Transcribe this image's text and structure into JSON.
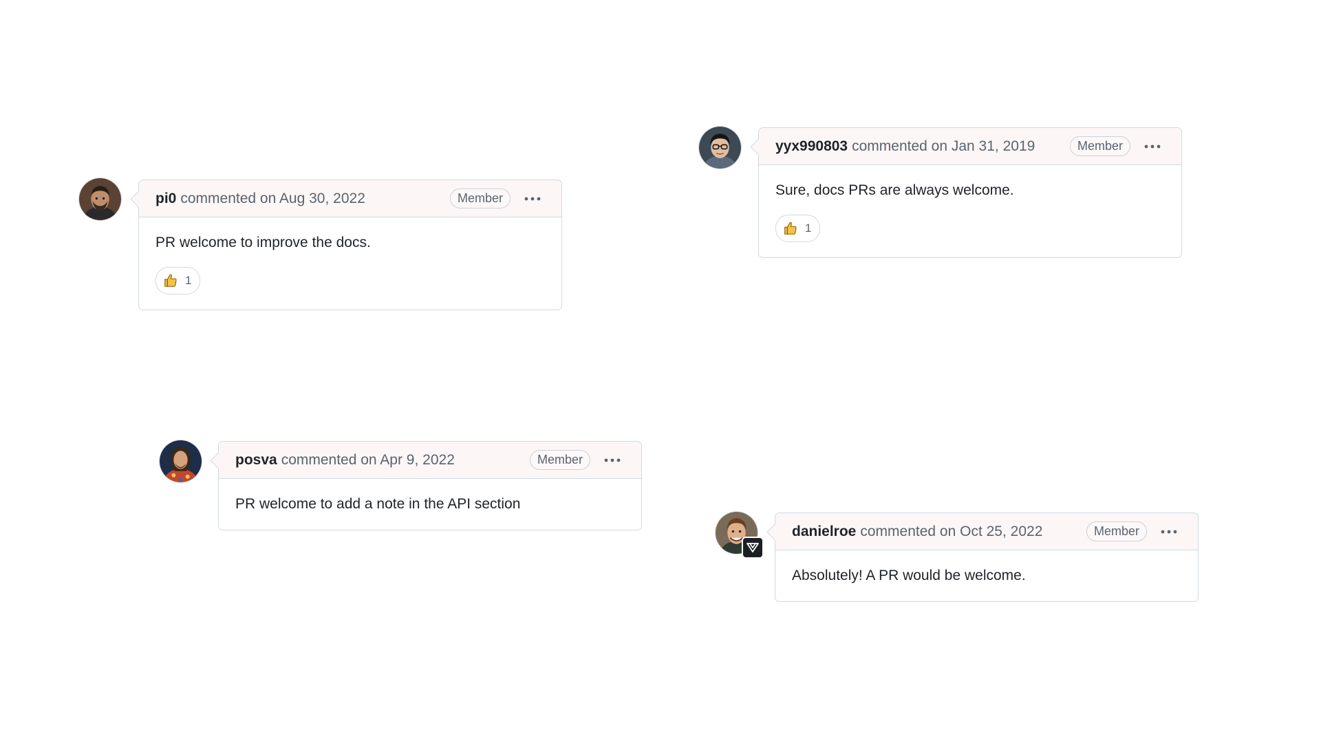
{
  "comments": [
    {
      "author": "pi0",
      "meta": "commented on Aug 30, 2022",
      "badge": "Member",
      "body": "PR welcome to improve the docs.",
      "reaction_count": "1"
    },
    {
      "author": "yyx990803",
      "meta": "commented on Jan 31, 2019",
      "badge": "Member",
      "body": "Sure, docs PRs are always welcome.",
      "reaction_count": "1"
    },
    {
      "author": "posva",
      "meta": "commented on Apr 9, 2022",
      "badge": "Member",
      "body": "PR welcome to add a note in the API section"
    },
    {
      "author": "danielroe",
      "meta": "commented on Oct 25, 2022",
      "badge": "Member",
      "body": "Absolutely! A PR would be welcome."
    }
  ],
  "icons": {
    "more": "kebab-horizontal-icon",
    "reaction": "thumbs-up-icon",
    "avatar_badge": "vercel-logo-icon"
  },
  "colors": {
    "header_bg": "#fdf6f6",
    "border": "#d1d9e0",
    "muted_text": "#59636e",
    "thumb": "#f6c244"
  }
}
